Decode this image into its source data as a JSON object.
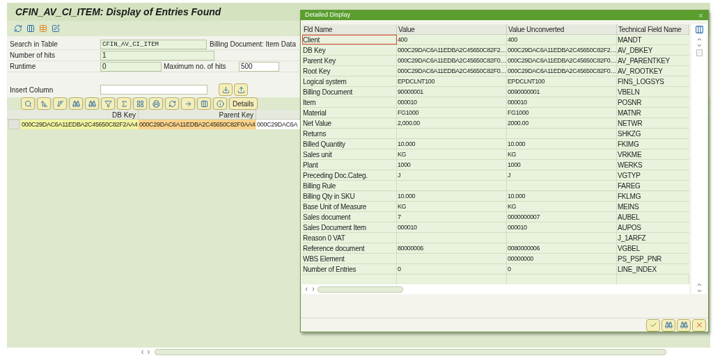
{
  "window": {
    "title": "CFIN_AV_CI_ITEM: Display of Entries Found"
  },
  "form": {
    "search_label": "Search in Table",
    "search_value": "CFIN_AV_CI_ITEM",
    "table_description": "Billing Document: Item Data",
    "hits_label": "Number of hits",
    "hits_value": "1",
    "runtime_label": "Runtime",
    "runtime_value": "0",
    "max_label": "Maximum no. of hits",
    "max_value": "500",
    "insert_label": "Insert Column"
  },
  "alv": {
    "details_button": "Details",
    "columns": [
      "DB Key",
      "Parent Key"
    ],
    "row": [
      {
        "text": "000C29DAC6A11EDBA2C45650C82F2AA4",
        "color": "#f2f5a0"
      },
      {
        "text": "000C29DAC6A11EDBA2C45650C82F0AA4",
        "color": "#fbd38a"
      },
      {
        "text": "000C29DAC6A",
        "color": "#ffffff"
      }
    ]
  },
  "dialog": {
    "title": "Detailed Display",
    "columns": [
      "Fld Name",
      "Value",
      "Value Unconverted",
      "Technical Field Name"
    ],
    "rows": [
      {
        "name": "Client",
        "value": "400",
        "unconverted": "400",
        "technical": "MANDT",
        "focused": true
      },
      {
        "name": "DB Key",
        "value": "000C29DAC6A11EDBA2C45650C82F2…",
        "unconverted": "000C29DAC6A11EDBA2C45650C82F2…",
        "technical": "AV_DBKEY",
        "focused": false
      },
      {
        "name": "Parent Key",
        "value": "000C29DAC6A11EDBA2C45650C82F0…",
        "unconverted": "000C29DAC6A11EDBA2C45650C82F0…",
        "technical": "AV_PARENTKEY",
        "focused": false
      },
      {
        "name": "Root Key",
        "value": "000C29DAC6A11EDBA2C45650C82F0…",
        "unconverted": "000C29DAC6A11EDBA2C45650C82F0…",
        "technical": "AV_ROOTKEY",
        "focused": false
      },
      {
        "name": "Logical system",
        "value": "EPDCLNT100",
        "unconverted": "EPDCLNT100",
        "technical": "FINS_LOGSYS",
        "focused": false
      },
      {
        "name": "Billing Document",
        "value": "90000001",
        "unconverted": "0090000001",
        "technical": "VBELN",
        "focused": false
      },
      {
        "name": "Item",
        "value": "000010",
        "unconverted": "000010",
        "technical": "POSNR",
        "focused": false
      },
      {
        "name": "Material",
        "value": "FG1000",
        "unconverted": "FG1000",
        "technical": "MATNR",
        "focused": false
      },
      {
        "name": "Net Value",
        "value": "2,000.00",
        "unconverted": "2000.00",
        "technical": "NETWR",
        "focused": false
      },
      {
        "name": "Returns",
        "value": "",
        "unconverted": "",
        "technical": "SHKZG",
        "focused": false
      },
      {
        "name": "Billed Quantity",
        "value": "10.000",
        "unconverted": "10.000",
        "technical": "FKIMG",
        "focused": false
      },
      {
        "name": "Sales unit",
        "value": "KG",
        "unconverted": "KG",
        "technical": "VRKME",
        "focused": false
      },
      {
        "name": "Plant",
        "value": "1000",
        "unconverted": "1000",
        "technical": "WERKS",
        "focused": false
      },
      {
        "name": "Preceding Doc.Categ.",
        "value": "J",
        "unconverted": "J",
        "technical": "VGTYP",
        "focused": false
      },
      {
        "name": "Billing Rule",
        "value": "",
        "unconverted": "",
        "technical": "FAREG",
        "focused": false
      },
      {
        "name": "Billing Qty in SKU",
        "value": "10.000",
        "unconverted": "10.000",
        "technical": "FKLMG",
        "focused": false
      },
      {
        "name": "Base Unit of Measure",
        "value": "KG",
        "unconverted": "KG",
        "technical": "MEINS",
        "focused": false
      },
      {
        "name": "Sales document",
        "value": "7",
        "unconverted": "0000000007",
        "technical": "AUBEL",
        "focused": false
      },
      {
        "name": "Sales Document Item",
        "value": "000010",
        "unconverted": "000010",
        "technical": "AUPOS",
        "focused": false
      },
      {
        "name": "Reason 0 VAT",
        "value": "",
        "unconverted": "",
        "technical": "J_1ARFZ",
        "focused": false
      },
      {
        "name": "Reference document",
        "value": "80000006",
        "unconverted": "0080000006",
        "technical": "VGBEL",
        "focused": false
      },
      {
        "name": "WBS Element",
        "value": "",
        "unconverted": "00000000",
        "technical": "PS_PSP_PNR",
        "focused": false
      },
      {
        "name": "Number of Entries",
        "value": "0",
        "unconverted": "0",
        "technical": "LINE_INDEX",
        "focused": false
      }
    ]
  }
}
